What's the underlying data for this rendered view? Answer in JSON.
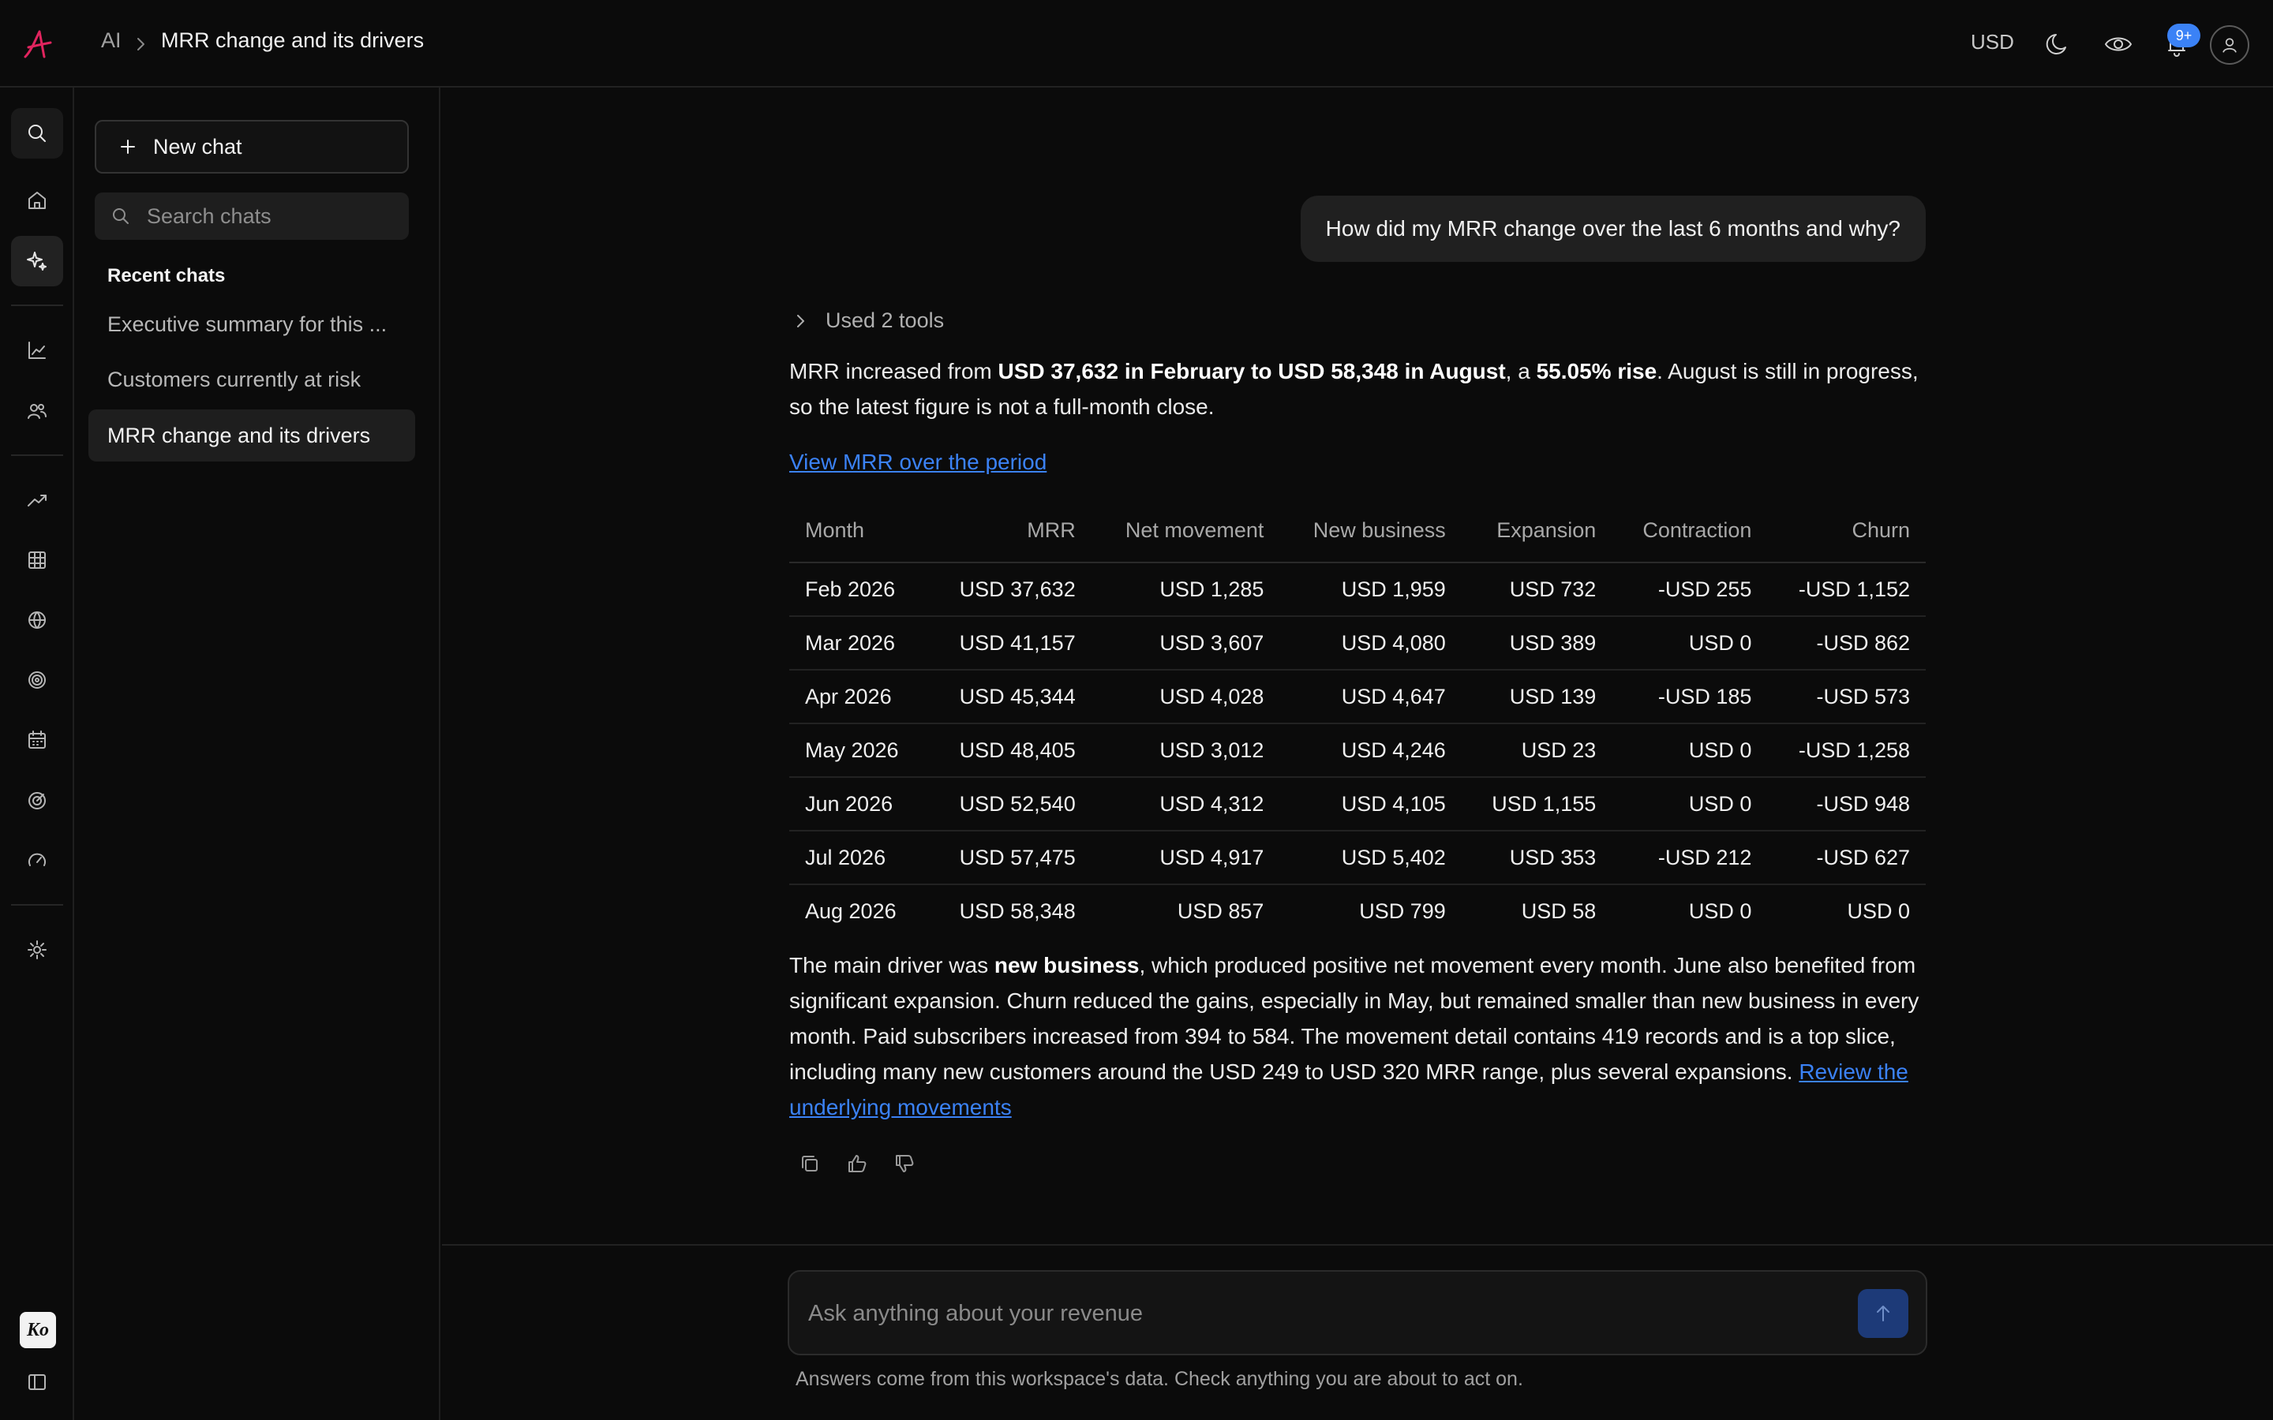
{
  "header": {
    "breadcrumb_root": "AI",
    "title": "MRR change and its drivers",
    "currency": "USD",
    "notification_count": "9+"
  },
  "rail": {
    "brand_logo": "Ko",
    "icons": [
      "search-icon",
      "home-icon",
      "sparkle-icon",
      "chart-icon",
      "users-icon",
      "trending-icon",
      "table-icon",
      "globe-icon",
      "target-icon",
      "calendar-icon",
      "radar-icon",
      "gauge-icon",
      "gear-icon",
      "sidebar-toggle-icon"
    ]
  },
  "sidebar": {
    "new_chat_label": "New chat",
    "search_placeholder": "Search chats",
    "recent_label": "Recent chats",
    "chats": [
      {
        "label": "Executive summary for this ..."
      },
      {
        "label": "Customers currently at risk"
      },
      {
        "label": "MRR change and its drivers"
      }
    ]
  },
  "conversation": {
    "user_message": "How did my MRR change over the last 6 months and why?",
    "tools_label": "Used 2 tools",
    "intro": {
      "p1": "MRR increased from ",
      "b1": "USD 37,632 in February to USD 58,348 in August",
      "p2": ", a ",
      "b2": "55.05% rise",
      "p3": ". August is still in progress, so the latest figure is not a full-month close."
    },
    "view_link": "View MRR over the period",
    "table": {
      "headers": [
        "Month",
        "MRR",
        "Net movement",
        "New business",
        "Expansion",
        "Contraction",
        "Churn"
      ],
      "rows": [
        [
          "Feb 2026",
          "USD 37,632",
          "USD 1,285",
          "USD 1,959",
          "USD 732",
          "-USD 255",
          "-USD 1,152"
        ],
        [
          "Mar 2026",
          "USD 41,157",
          "USD 3,607",
          "USD 4,080",
          "USD 389",
          "USD 0",
          "-USD 862"
        ],
        [
          "Apr 2026",
          "USD 45,344",
          "USD 4,028",
          "USD 4,647",
          "USD 139",
          "-USD 185",
          "-USD 573"
        ],
        [
          "May 2026",
          "USD 48,405",
          "USD 3,012",
          "USD 4,246",
          "USD 23",
          "USD 0",
          "-USD 1,258"
        ],
        [
          "Jun 2026",
          "USD 52,540",
          "USD 4,312",
          "USD 4,105",
          "USD 1,155",
          "USD 0",
          "-USD 948"
        ],
        [
          "Jul 2026",
          "USD 57,475",
          "USD 4,917",
          "USD 5,402",
          "USD 353",
          "-USD 212",
          "-USD 627"
        ],
        [
          "Aug 2026",
          "USD 58,348",
          "USD 857",
          "USD 799",
          "USD 58",
          "USD 0",
          "USD 0"
        ]
      ]
    },
    "summary": {
      "p1": "The main driver was ",
      "b1": "new business",
      "p2": ", which produced positive net movement every month. June also benefited from significant expansion. Churn reduced the gains, especially in May, but remained smaller than new business in every month. Paid subscribers increased from 394 to 584. The movement detail contains 419 records and is a top slice, including many new customers around the USD 249 to USD 320 MRR range, plus several expansions. ",
      "link": "Review the underlying movements"
    }
  },
  "composer": {
    "placeholder": "Ask anything about your revenue",
    "disclaimer": "Answers come from this workspace's data. Check anything you are about to act on."
  },
  "colors": {
    "background": "#0b0b0b",
    "accent_link": "#3b82f6",
    "brand": "#e0245e",
    "badge": "#3b82f6"
  }
}
